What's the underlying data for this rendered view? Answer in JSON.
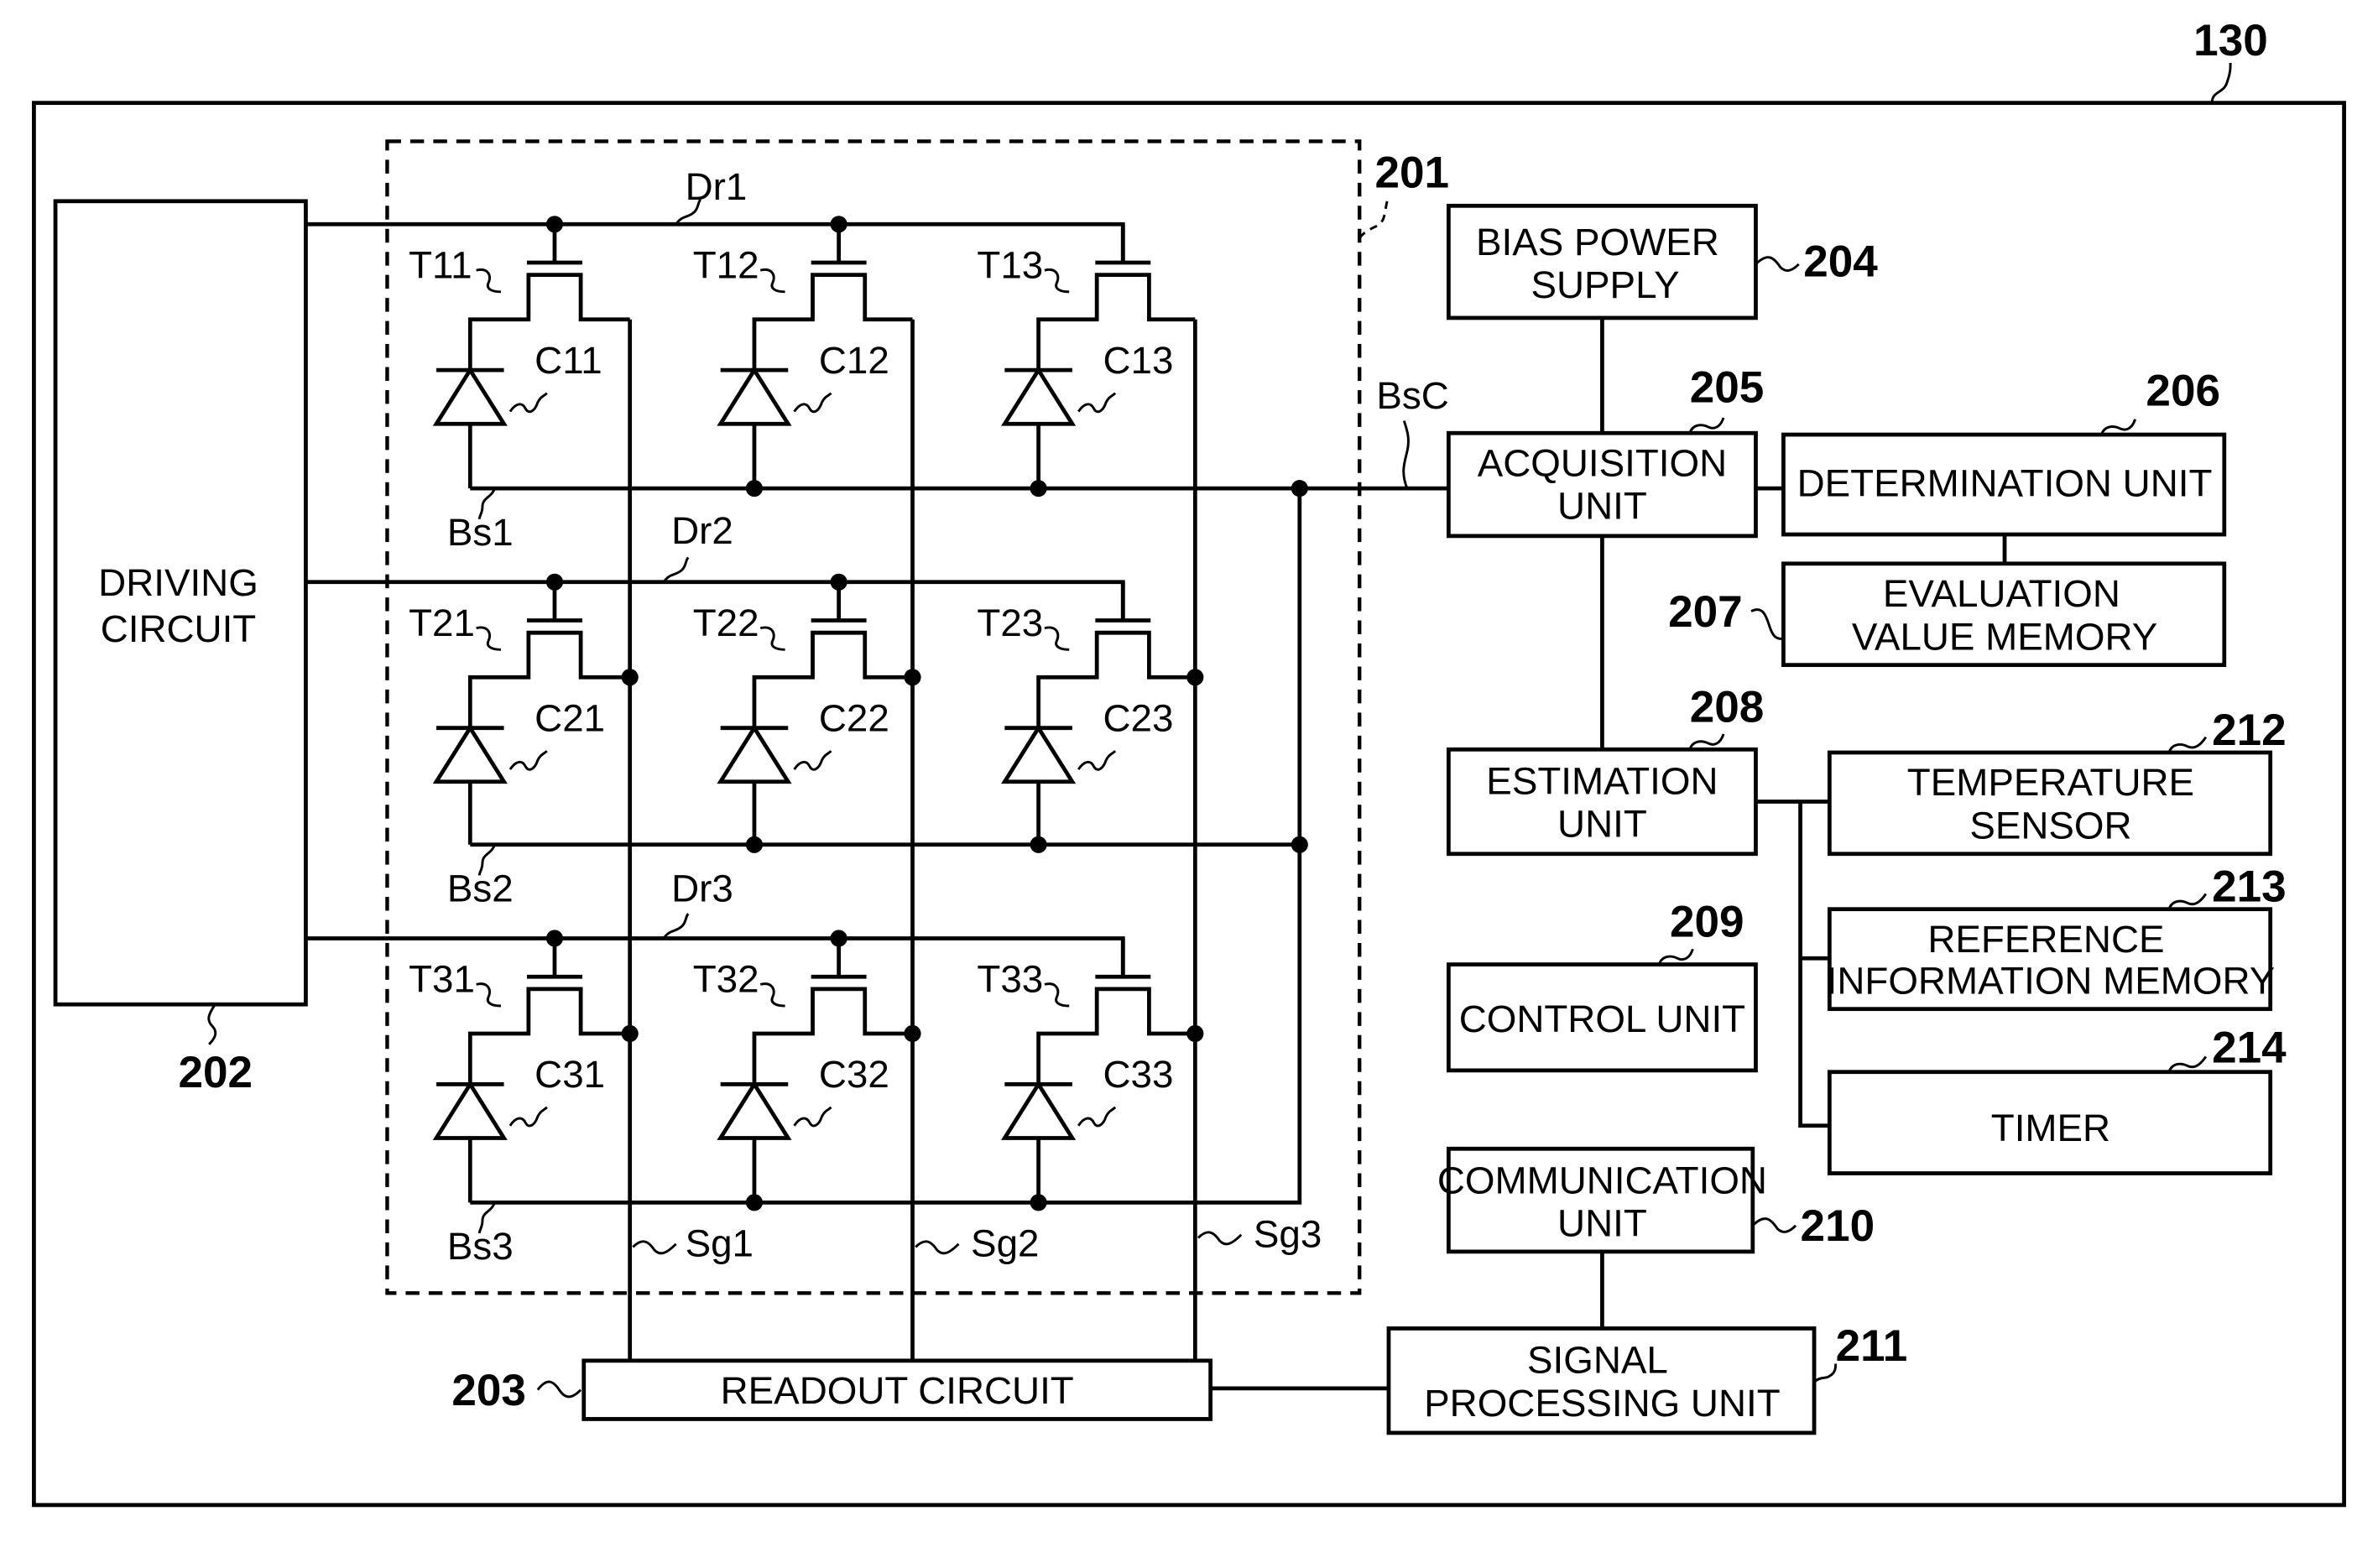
{
  "figure": {
    "ref_outer": "130",
    "ref_array": "201",
    "driving_circuit": {
      "ref": "202",
      "lines": [
        "DRIVING",
        "CIRCUIT"
      ]
    },
    "readout_circuit": {
      "ref": "203",
      "label": "READOUT CIRCUIT"
    },
    "drive_lines": [
      "Dr1",
      "Dr2",
      "Dr3"
    ],
    "bias_lines": [
      "Bs1",
      "Bs2",
      "Bs3"
    ],
    "signal_lines": [
      "Sg1",
      "Sg2",
      "Sg3"
    ],
    "bias_common": "BsC",
    "transistors": [
      [
        "T11",
        "T12",
        "T13"
      ],
      [
        "T21",
        "T22",
        "T23"
      ],
      [
        "T31",
        "T32",
        "T33"
      ]
    ],
    "conversion_elements": [
      [
        "C11",
        "C12",
        "C13"
      ],
      [
        "C21",
        "C22",
        "C23"
      ],
      [
        "C31",
        "C32",
        "C33"
      ]
    ],
    "blocks": {
      "bias_power_supply": {
        "ref": "204",
        "lines": [
          "BIAS POWER",
          "SUPPLY"
        ]
      },
      "acquisition_unit": {
        "ref": "205",
        "lines": [
          "ACQUISITION",
          "UNIT"
        ]
      },
      "determination_unit": {
        "ref": "206",
        "lines": [
          "DETERMINATION UNIT"
        ]
      },
      "evaluation_value_memory": {
        "ref": "207",
        "lines": [
          "EVALUATION",
          "VALUE MEMORY"
        ]
      },
      "estimation_unit": {
        "ref": "208",
        "lines": [
          "ESTIMATION",
          "UNIT"
        ]
      },
      "control_unit": {
        "ref": "209",
        "lines": [
          "CONTROL UNIT"
        ]
      },
      "communication_unit": {
        "ref": "210",
        "lines": [
          "COMMUNICATION",
          "UNIT"
        ]
      },
      "signal_processing_unit": {
        "ref": "211",
        "lines": [
          "SIGNAL",
          "PROCESSING UNIT"
        ]
      },
      "temperature_sensor": {
        "ref": "212",
        "lines": [
          "TEMPERATURE",
          "SENSOR"
        ]
      },
      "reference_information_memory": {
        "ref": "213",
        "lines": [
          "REFERENCE",
          "INFORMATION MEMORY"
        ]
      },
      "timer": {
        "ref": "214",
        "lines": [
          "TIMER"
        ]
      }
    }
  }
}
